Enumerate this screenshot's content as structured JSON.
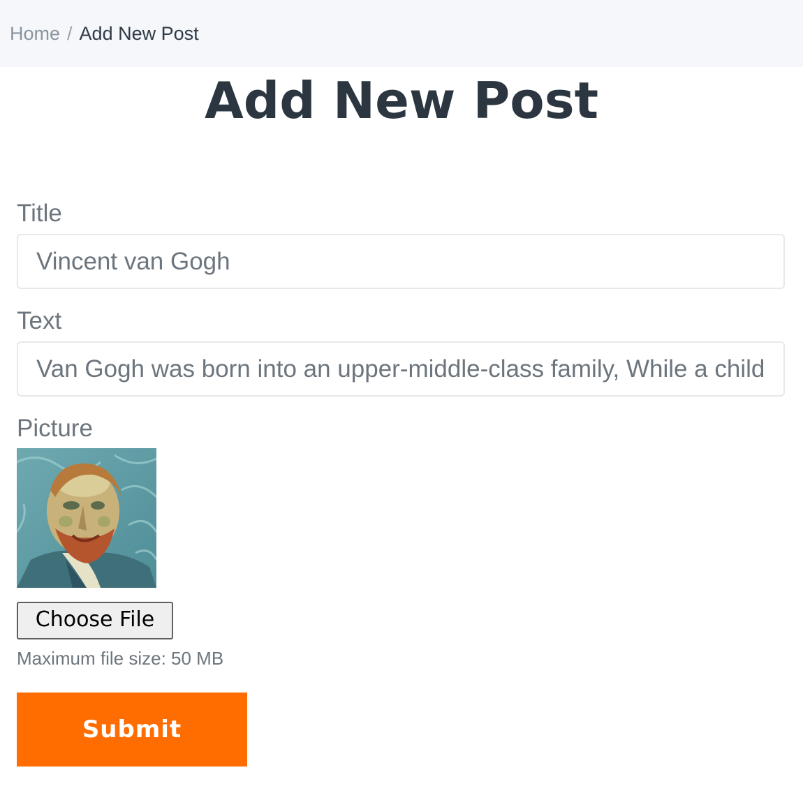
{
  "breadcrumb": {
    "home": "Home",
    "separator": "/",
    "current": "Add New Post"
  },
  "page_title": "Add New Post",
  "form": {
    "title_label": "Title",
    "title_value": "Vincent van Gogh",
    "text_label": "Text",
    "text_value": "Van Gogh was born into an upper-middle-class family, While a child he was serious, quiet and thoughtful.",
    "picture_label": "Picture",
    "picture_icon": "portrait-thumbnail-image",
    "file_button_label": "Choose File",
    "file_hint": "Maximum file size: 50 MB",
    "submit_label": "Submit"
  },
  "colors": {
    "accent": "#ff6d00",
    "breadcrumb_bg": "#f5f7fa",
    "label": "#6c757d",
    "heading": "#2b3640"
  }
}
